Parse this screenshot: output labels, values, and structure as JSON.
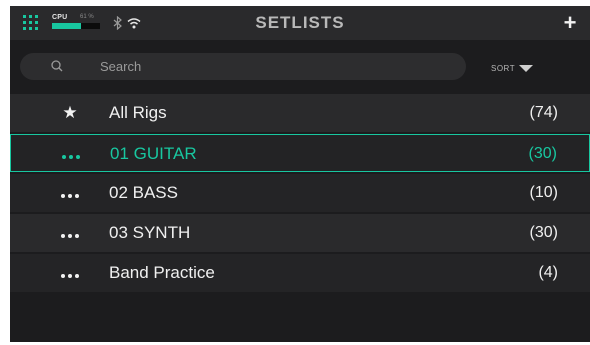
{
  "header": {
    "title": "SETLISTS",
    "add_label": "+",
    "status": {
      "cpu_label": "CPU",
      "cpu_percent_label": "61 %",
      "cpu_level": 0.61
    }
  },
  "search": {
    "placeholder": "Search"
  },
  "sort": {
    "label": "SORT"
  },
  "setlists": [
    {
      "icon": "star-icon",
      "name": "All Rigs",
      "count": "(74)",
      "selected": false
    },
    {
      "icon": "more-icon",
      "name": "01 GUITAR",
      "count": "(30)",
      "selected": true
    },
    {
      "icon": "more-icon",
      "name": "02 BASS",
      "count": "(10)",
      "selected": false
    },
    {
      "icon": "more-icon",
      "name": "03 SYNTH",
      "count": "(30)",
      "selected": false
    },
    {
      "icon": "more-icon",
      "name": "Band Practice",
      "count": "(4)",
      "selected": false
    }
  ],
  "colors": {
    "accent": "#18c7a0",
    "background": "#1c1c1e",
    "row": "#2a2a2c"
  }
}
